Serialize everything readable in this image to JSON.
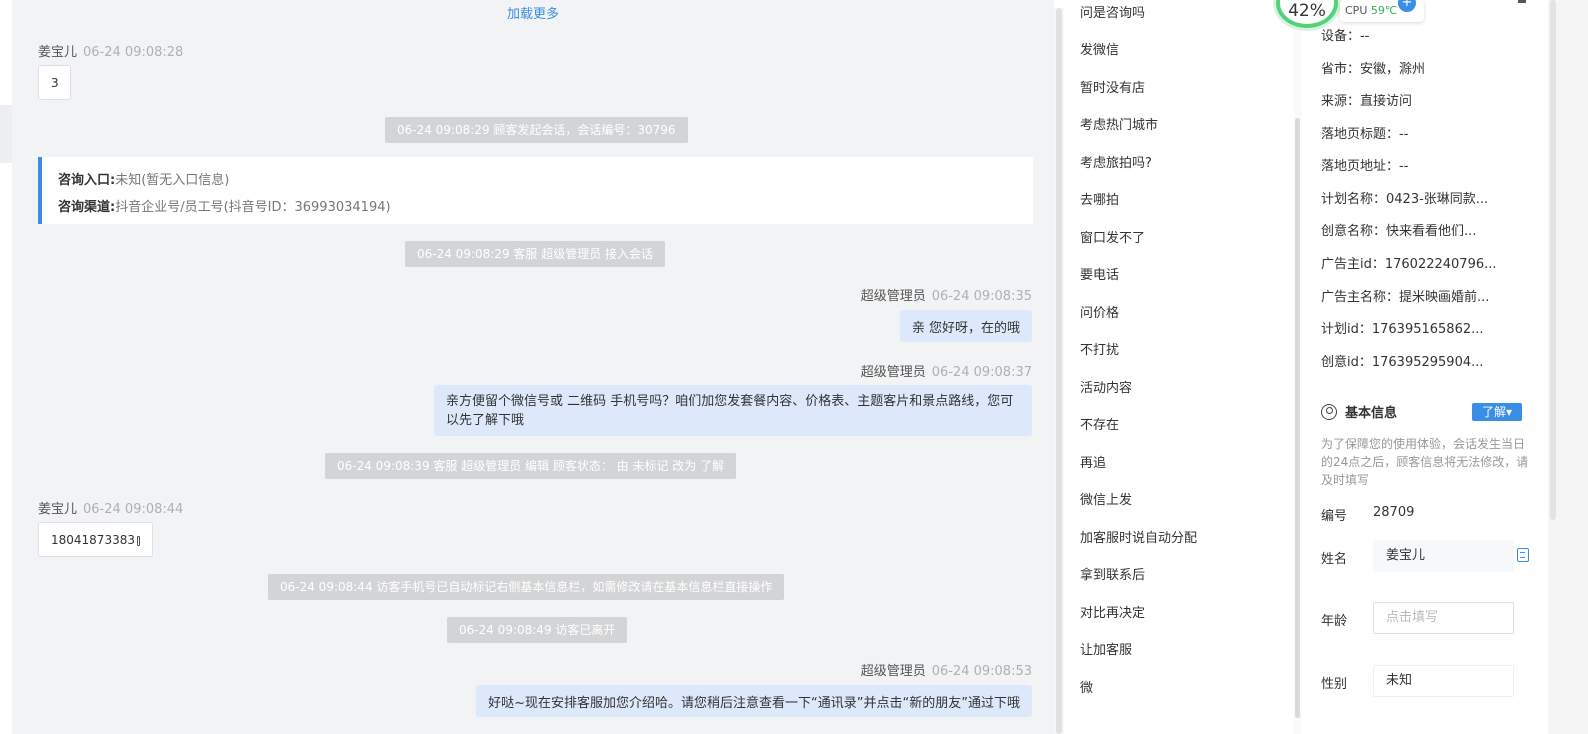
{
  "chat": {
    "load_more": "加载更多",
    "messages": [
      {
        "sender": "姜宝儿",
        "time": "06-24 09:08:28",
        "text": "3"
      },
      {
        "system": "06-24 09:08:29 顾客发起会话，会话编号：30796"
      },
      {
        "system": "06-24 09:08:29 客服 超级管理员 接入会话"
      },
      {
        "sender": "超级管理员",
        "time": "06-24 09:08:35",
        "text": "亲 您好呀，在的哦"
      },
      {
        "sender": "超级管理员",
        "time": "06-24 09:08:37",
        "text": "亲方便留个微信号或 二维码 手机号吗？咱们加您发套餐内容、价格表、主题客片和景点路线，您可以先了解下哦"
      },
      {
        "system": "06-24 09:08:39 客服 超级管理员 编辑 顾客状态： 由 未标记 改为 了解"
      },
      {
        "sender": "姜宝儿",
        "time": "06-24 09:08:44",
        "text": "18041873383"
      },
      {
        "system": "06-24 09:08:44 访客手机号已自动标记右侧基本信息栏，如需修改请在基本信息栏直接操作"
      },
      {
        "system": "06-24 09:08:49 访客已离开"
      },
      {
        "sender": "超级管理员",
        "time": "06-24 09:08:53",
        "text": "好哒~现在安排客服加您介绍哈。请您稍后注意查看一下“通讯录”并点击“新的朋友”通过下哦"
      }
    ],
    "entry_card": {
      "entry_label": "咨询入口:",
      "entry_value": "未知(暂无入口信息)",
      "channel_label": "咨询渠道:",
      "channel_value": "抖音企业号/员工号(抖音号ID：36993034194)"
    }
  },
  "quick_replies": [
    "问是咨询吗",
    "发微信",
    "暂时没有店",
    "考虑热门城市",
    "考虑旅拍吗?",
    "去哪拍",
    "窗口发不了",
    "要电话",
    "问价格",
    "不打扰",
    "活动内容",
    "不存在",
    "再追",
    "微信上发",
    "加客服时说自动分配",
    "拿到联系后",
    "对比再决定",
    "让加客服",
    "微"
  ],
  "info": {
    "rows": [
      "设备：--",
      "省市：安徽，滁州",
      "来源：直接访问",
      "落地页标题：--",
      "落地页地址：--",
      "计划名称：0423-张琳同款...",
      "创意名称：快来看看他们...",
      "广告主id：176022240796...",
      "广告主名称：提米映画婚前...",
      "计划id：176395165862...",
      "创意id：176395295904..."
    ],
    "section_title": "基本信息",
    "learn_label": "了解▾",
    "notice": "为了保障您的使用体验，会话发生当日的24点之后，顾客信息将无法修改，请及时填写",
    "fields": {
      "id_label": "编号",
      "id_value": "28709",
      "name_label": "姓名",
      "name_value": "姜宝儿",
      "age_label": "年龄",
      "age_placeholder": "点击填写",
      "gender_label": "性别",
      "gender_value": "未知"
    }
  },
  "cpu_widget": {
    "percent": "42%",
    "cpu_label": "CPU",
    "temp": "59℃"
  },
  "colors": {
    "accent": "#3a8ee6",
    "bubble_right": "#dde8fb",
    "system_msg": "#d3d4d6",
    "chat_bg": "#f2f3f5"
  }
}
